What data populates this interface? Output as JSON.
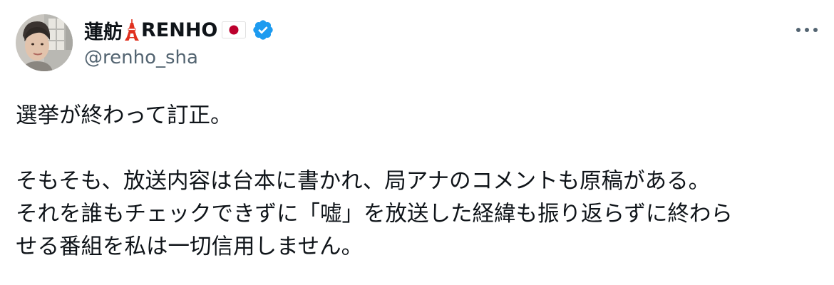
{
  "author": {
    "display_name": "蓮舫",
    "display_name_suffix": "RENHO",
    "handle": "@renho_sha",
    "verified": true,
    "badges": [
      "tokyo-tower-emoji",
      "japan-flag-emoji",
      "verified-badge-icon"
    ],
    "verified_color": "#1d9bf0"
  },
  "menu": {
    "more_icon": "more-horizontal-icon"
  },
  "tweet": {
    "lines": [
      "選挙が終わって訂正。",
      "",
      "そもそも、放送内容は台本に書かれ、局アナのコメントも原稿がある。",
      "それを誰もチェックできずに「嘘」を放送した経緯も振り返らずに終わら",
      "せる番組を私は一切信用しません。"
    ]
  },
  "colors": {
    "text_primary": "#0f1419",
    "text_secondary": "#536471",
    "verified_blue": "#1d9bf0",
    "flag_red": "#bc002d",
    "tower_red": "#e0301e"
  }
}
